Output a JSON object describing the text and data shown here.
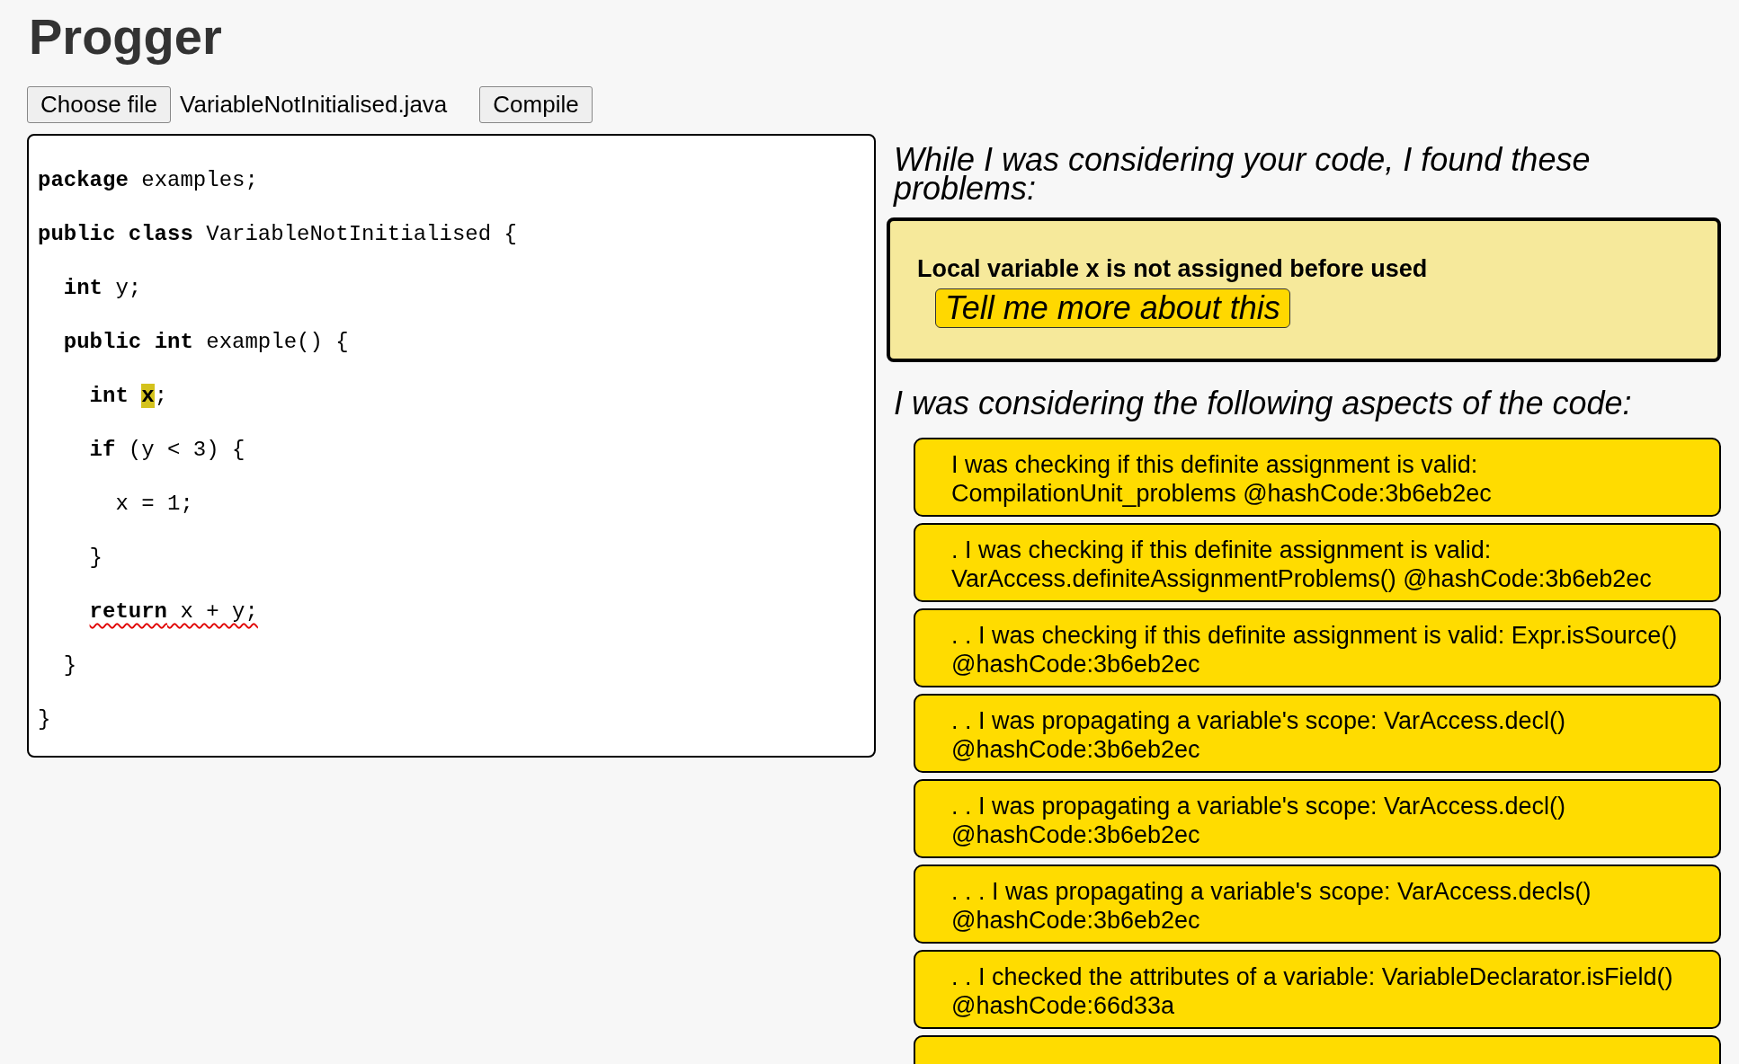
{
  "app_title": "Progger",
  "file_picker": {
    "button": "Choose file",
    "file_name": "VariableNotInitialised.java"
  },
  "compile_button": "Compile",
  "code_lines": [
    {
      "error": false,
      "tokens": [
        {
          "kind": "keyword",
          "text": "package"
        },
        {
          "kind": "plain",
          "text": " examples;"
        }
      ]
    },
    {
      "error": false,
      "tokens": [
        {
          "kind": "keyword",
          "text": "public class"
        },
        {
          "kind": "plain",
          "text": " VariableNotInitialised {"
        }
      ]
    },
    {
      "error": false,
      "tokens": [
        {
          "kind": "keyword",
          "text": "  int"
        },
        {
          "kind": "plain",
          "text": " y;"
        }
      ]
    },
    {
      "error": false,
      "tokens": [
        {
          "kind": "keyword",
          "text": "  public int"
        },
        {
          "kind": "plain",
          "text": " example() {"
        }
      ]
    },
    {
      "error": false,
      "tokens": [
        {
          "kind": "keyword",
          "text": "    int "
        },
        {
          "kind": "highlight",
          "text": "x"
        },
        {
          "kind": "plain",
          "text": ";"
        }
      ]
    },
    {
      "error": false,
      "tokens": [
        {
          "kind": "keyword",
          "text": "    if"
        },
        {
          "kind": "plain",
          "text": " (y < 3) {"
        }
      ]
    },
    {
      "error": false,
      "tokens": [
        {
          "kind": "plain",
          "text": "      x = 1;"
        }
      ]
    },
    {
      "error": false,
      "tokens": [
        {
          "kind": "plain",
          "text": "    }"
        }
      ]
    },
    {
      "error": true,
      "tokens": [
        {
          "kind": "keyword",
          "text": "    return"
        },
        {
          "kind": "plain",
          "text": " x + y;"
        }
      ]
    },
    {
      "error": false,
      "tokens": [
        {
          "kind": "plain",
          "text": "  }"
        }
      ]
    },
    {
      "error": false,
      "tokens": [
        {
          "kind": "plain",
          "text": "}"
        }
      ]
    }
  ],
  "problems_heading": "While I was considering your code, I found these problems:",
  "problems": [
    {
      "message": "Local variable x is not assigned before used",
      "button": "Tell me more about this"
    }
  ],
  "aspects_heading": "I was considering the following aspects of the code:",
  "aspects": [
    {
      "kind": "item",
      "text": "I was checking if this definite assignment is valid: CompilationUnit_problems @hashCode:3b6eb2ec"
    },
    {
      "kind": "item",
      "text": ". I was checking if this definite assignment is valid: VarAccess.definiteAssignmentProblems() @hashCode:3b6eb2ec"
    },
    {
      "kind": "item",
      "text": ". . I was checking if this definite assignment is valid: Expr.isSource() @hashCode:3b6eb2ec"
    },
    {
      "kind": "item",
      "text": ". . I was propagating a variable's scope: VarAccess.decl() @hashCode:3b6eb2ec"
    },
    {
      "kind": "item",
      "text": ". . I was propagating a variable's scope: VarAccess.decl() @hashCode:3b6eb2ec"
    },
    {
      "kind": "item",
      "text": ". . . I was propagating a variable's scope: VarAccess.decls() @hashCode:3b6eb2ec"
    },
    {
      "kind": "item",
      "text": ". . I checked the attributes of a variable: VariableDeclarator.isField() @hashCode:66d33a"
    },
    {
      "kind": "cut"
    }
  ]
}
